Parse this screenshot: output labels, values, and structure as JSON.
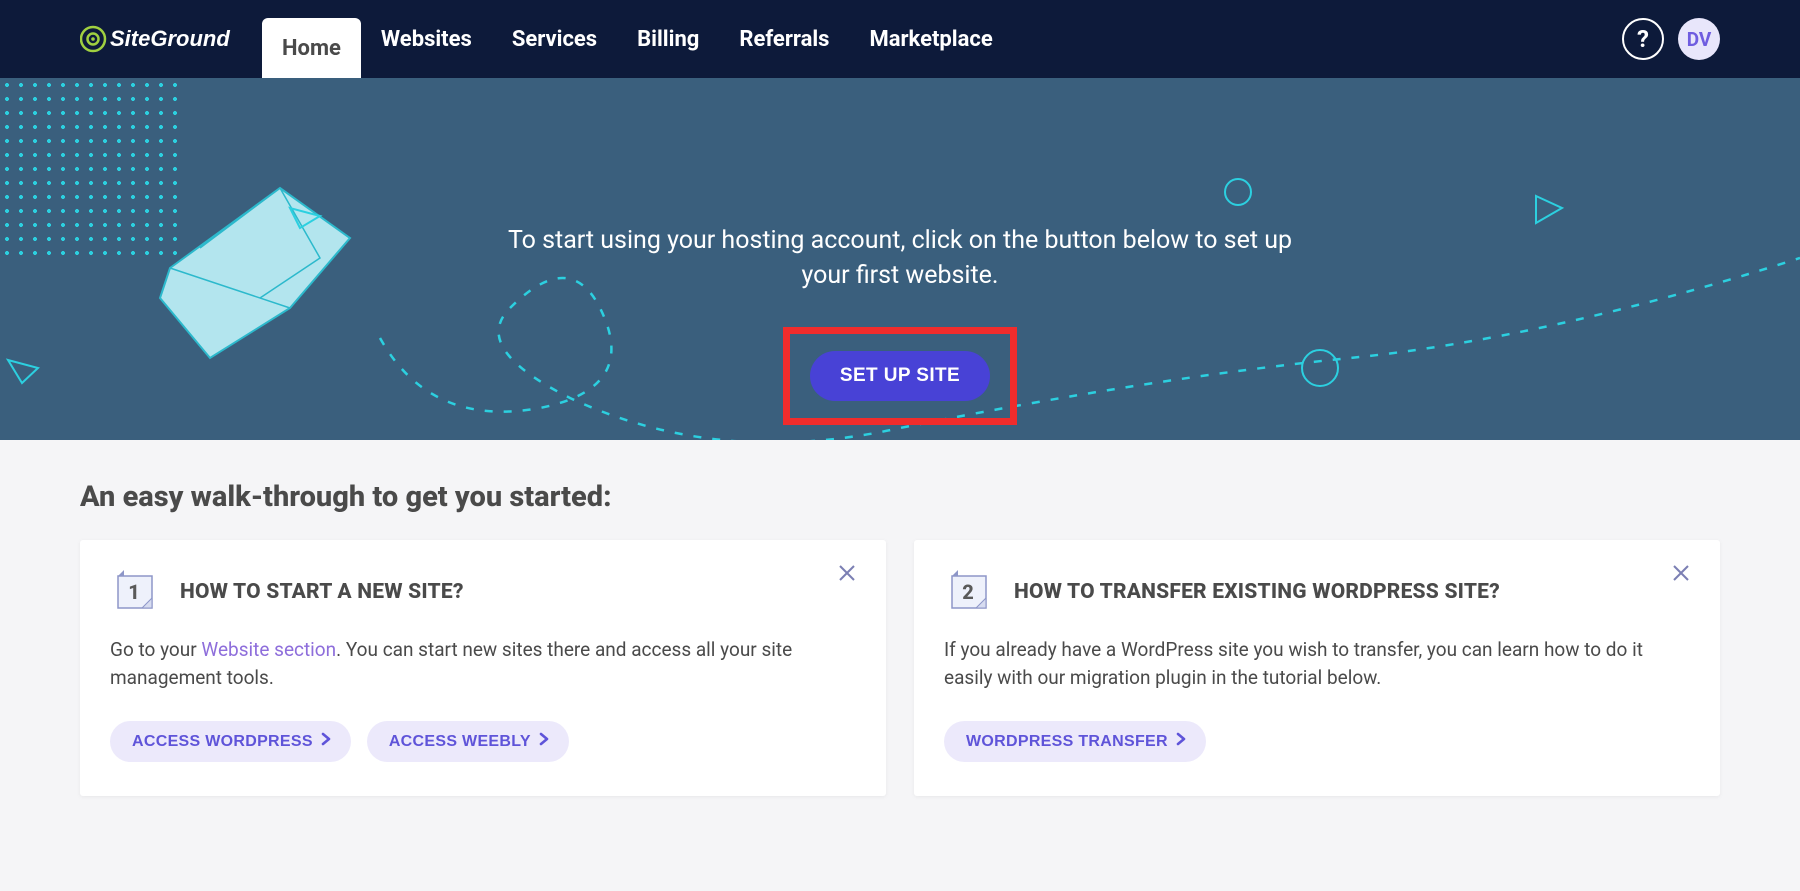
{
  "brand": "SiteGround",
  "nav": {
    "items": [
      {
        "label": "Home",
        "active": true
      },
      {
        "label": "Websites"
      },
      {
        "label": "Services"
      },
      {
        "label": "Billing"
      },
      {
        "label": "Referrals"
      },
      {
        "label": "Marketplace"
      }
    ],
    "help_glyph": "?",
    "avatar_initials": "DV"
  },
  "hero": {
    "message": "To start using your hosting account, click on the button below to set up your first website.",
    "cta_label": "SET UP SITE"
  },
  "section": {
    "title": "An easy walk-through to get you started:"
  },
  "cards": [
    {
      "num": "1",
      "title": "HOW TO START A NEW SITE?",
      "body_prefix": "Go to your ",
      "body_link": "Website section",
      "body_suffix": ". You can start new sites there and access all your site management tools.",
      "actions": [
        "ACCESS WORDPRESS",
        "ACCESS WEEBLY"
      ]
    },
    {
      "num": "2",
      "title": "HOW TO TRANSFER EXISTING WORDPRESS SITE?",
      "body_prefix": "If you already have a WordPress site you wish to transfer, you can learn how to do it easily with our migration plugin in the tutorial below.",
      "body_link": "",
      "body_suffix": "",
      "actions": [
        "WORDPRESS TRANSFER"
      ]
    }
  ],
  "colors": {
    "nav_bg": "#0d1a3a",
    "hero_bg": "#3a5f7d",
    "accent_teal": "#2cd0e0",
    "cta_purple": "#4842d6",
    "highlight_border": "#f02c2c",
    "pill_bg": "#ece9fb",
    "pill_fg": "#5f54d9",
    "link": "#8e6edb"
  }
}
